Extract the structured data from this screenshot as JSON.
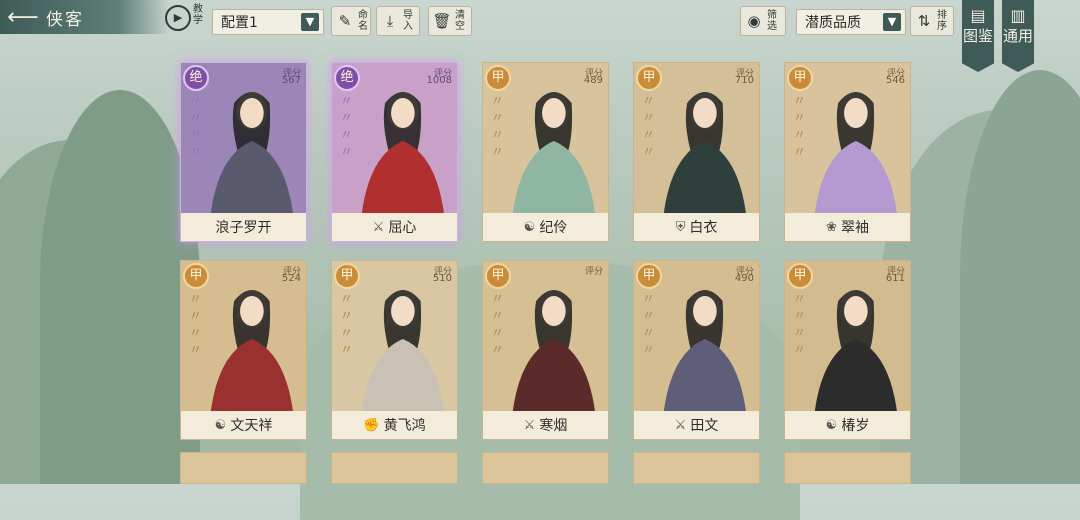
{
  "header": {
    "back_icon": "arrow-left-icon",
    "title": "侠客",
    "tutorial_label": "教学",
    "loadout_value": "配置1",
    "rename_label": "命名",
    "import_label": "导入",
    "clear_label": "清空",
    "filter_label": "筛选",
    "sort_field_value": "潜质品质",
    "sort_label": "排序"
  },
  "side_tabs": [
    {
      "label": "图鉴",
      "icon": "book-icon"
    },
    {
      "label": "通用",
      "icon": "scroll-icon"
    }
  ],
  "score_label": "评分",
  "heroes": [
    {
      "name": "浪子罗开",
      "rank": "绝",
      "score": "567",
      "tier": "purple",
      "school_icon": ""
    },
    {
      "name": "屈心",
      "rank": "绝",
      "score": "1008",
      "tier": "purple",
      "school_icon": "sword-icon"
    },
    {
      "name": "纪伶",
      "rank": "甲",
      "score": "489",
      "tier": "gold",
      "school_icon": "swirl-icon"
    },
    {
      "name": "白衣",
      "rank": "甲",
      "score": "710",
      "tier": "gold",
      "school_icon": "shield-icon"
    },
    {
      "name": "翠袖",
      "rank": "甲",
      "score": "546",
      "tier": "gold",
      "school_icon": "lotus-icon"
    },
    {
      "name": "文天祥",
      "rank": "甲",
      "score": "524",
      "tier": "gold",
      "school_icon": "swirl-icon"
    },
    {
      "name": "黄飞鸿",
      "rank": "甲",
      "score": "510",
      "tier": "gold",
      "school_icon": "fist-icon"
    },
    {
      "name": "寒烟",
      "rank": "甲",
      "score": "",
      "tier": "gold",
      "school_icon": "sword-icon"
    },
    {
      "name": "田文",
      "rank": "甲",
      "score": "490",
      "tier": "gold",
      "school_icon": "sword-icon"
    },
    {
      "name": "椿岁",
      "rank": "甲",
      "score": "611",
      "tier": "gold",
      "school_icon": "swirl-icon"
    }
  ]
}
